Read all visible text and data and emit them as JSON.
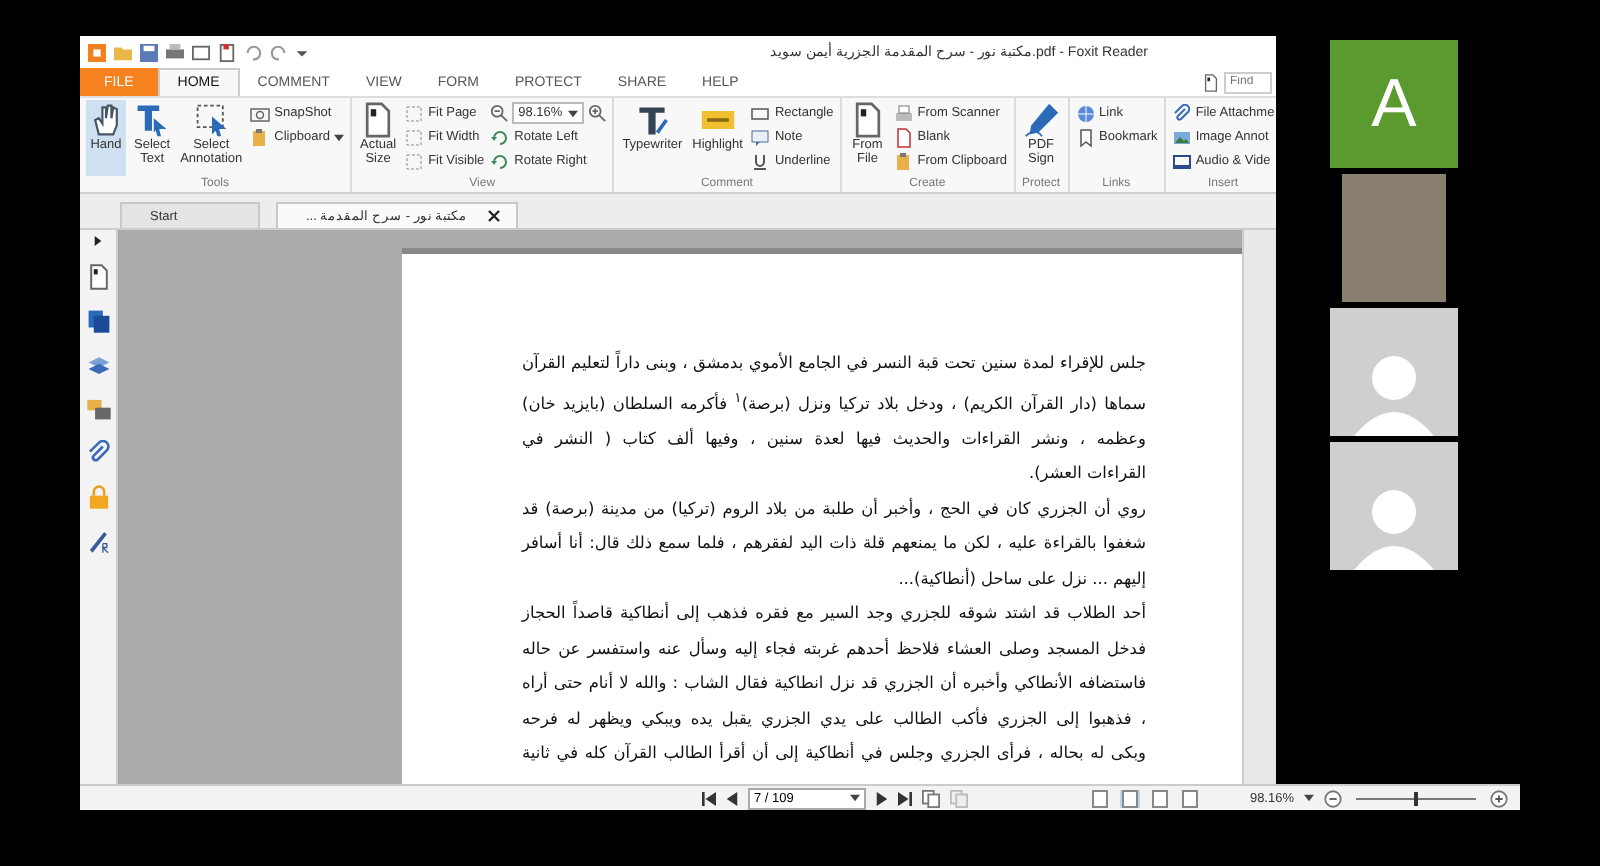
{
  "window": {
    "title": "مكتبة نور - سرح المقدمة الجزرية أيمن سويد.pdf - Foxit Reader"
  },
  "menu_tabs": [
    {
      "label": "FILE",
      "kind": "file",
      "selected": false
    },
    {
      "label": "HOME",
      "kind": "tab",
      "selected": true
    },
    {
      "label": "COMMENT",
      "kind": "tab",
      "selected": false
    },
    {
      "label": "VIEW",
      "kind": "tab",
      "selected": false
    },
    {
      "label": "FORM",
      "kind": "tab",
      "selected": false
    },
    {
      "label": "PROTECT",
      "kind": "tab",
      "selected": false
    },
    {
      "label": "SHARE",
      "kind": "tab",
      "selected": false
    },
    {
      "label": "HELP",
      "kind": "tab",
      "selected": false
    }
  ],
  "find": {
    "placeholder": "Find"
  },
  "ribbon": {
    "groups": [
      {
        "label": "Tools",
        "columns": [
          {
            "kind": "large",
            "items": [
              {
                "label": "Hand",
                "selected": true
              }
            ]
          },
          {
            "kind": "large",
            "items": [
              {
                "label": "Select Text",
                "selected": false
              }
            ]
          },
          {
            "kind": "large",
            "items": [
              {
                "label": "Select Annotation",
                "selected": false
              }
            ]
          },
          {
            "kind": "small",
            "items": [
              {
                "label": "SnapShot"
              },
              {
                "label": "Clipboard",
                "dropdown": true
              }
            ]
          }
        ]
      },
      {
        "label": "View",
        "columns": [
          {
            "kind": "large",
            "items": [
              {
                "label": "Actual Size"
              }
            ]
          },
          {
            "kind": "small",
            "items": [
              {
                "label": "Fit Page"
              },
              {
                "label": "Fit Width"
              },
              {
                "label": "Fit Visible"
              }
            ]
          },
          {
            "kind": "small",
            "items": [
              {
                "kind": "zoom",
                "value": "98.16%"
              },
              {
                "label": "Rotate Left"
              },
              {
                "label": "Rotate Right"
              }
            ]
          }
        ]
      },
      {
        "label": "Comment",
        "columns": [
          {
            "kind": "large",
            "items": [
              {
                "label": "Typewriter"
              }
            ]
          },
          {
            "kind": "large",
            "items": [
              {
                "label": "Highlight"
              }
            ]
          },
          {
            "kind": "small",
            "items": [
              {
                "label": "Rectangle"
              },
              {
                "label": "Note"
              },
              {
                "label": "Underline"
              }
            ]
          }
        ]
      },
      {
        "label": "Create",
        "columns": [
          {
            "kind": "large",
            "items": [
              {
                "label": "From File"
              }
            ]
          },
          {
            "kind": "small",
            "items": [
              {
                "label": "From Scanner"
              },
              {
                "label": "Blank"
              },
              {
                "label": "From Clipboard"
              }
            ]
          }
        ]
      },
      {
        "label": "Protect",
        "columns": [
          {
            "kind": "large",
            "items": [
              {
                "label": "PDF Sign"
              }
            ]
          }
        ]
      },
      {
        "label": "Links",
        "columns": [
          {
            "kind": "small",
            "items": [
              {
                "label": "Link"
              },
              {
                "label": "Bookmark"
              }
            ]
          }
        ]
      },
      {
        "label": "Insert",
        "columns": [
          {
            "kind": "small",
            "items": [
              {
                "label": "File Attachme"
              },
              {
                "label": "Image Annot"
              },
              {
                "label": "Audio & Vide"
              }
            ]
          }
        ]
      }
    ]
  },
  "doc_tabs": [
    {
      "label": "Start",
      "selected": false,
      "closable": false
    },
    {
      "label": "... مكتبة نور - سرح المقدمة",
      "selected": true,
      "closable": true
    }
  ],
  "page": {
    "lines": [
      {
        "text": "جلس للإقراء لمدة سنين تحت قبة النسر في الجامع الأموي بدمشق ، وبنى داراً لتعليم القرآن",
        "last": false
      },
      {
        "text": "سماها (دار القرآن الكريم) ، ودخل بلاد تركيا ونزل (برصة)$^{١}$ فأكرمه السلطان (بايزيد خان)",
        "last": false
      },
      {
        "text": "وعظمه ، ونشر القراءات والحديث فيها لعدة سنين ، وفيها ألف كتاب ( النشر في",
        "last": false
      },
      {
        "text": "القراءات العشر).",
        "last": true
      },
      {
        "text": "روي أن الجزري كان في الحج ، وأخبر أن طلبة من بلاد الروم (تركيا) من مدينة (برصة) قد",
        "last": false
      },
      {
        "text": "شغفوا بالقراءة عليه ، لكن ما يمنعهم قلة ذات اليد لفقرهم ، فلما سمع ذلك قال: أنا أسافر",
        "last": false
      },
      {
        "text": "إليهم ... نزل على ساحل (أنطاكية)...",
        "last": true
      },
      {
        "text": "أحد الطلاب قد اشتد شوقه للجزري وجد السير مع فقره فذهب إلى أنطاكية قاصداً الحجاز",
        "last": false
      },
      {
        "text": "فدخل المسجد وصلى العشاء فلاحظ أحدهم غربته فجاء إليه وسأل عنه واستفسر عن حاله",
        "last": false
      },
      {
        "text": "فاستضافه الأنطاكي وأخبره أن الجزري قد نزل انطاكية فقال الشاب : والله لا أنام حتى أراه",
        "last": false
      },
      {
        "text": "، فذهبوا إلى الجزري فأكب الطالب على يدي الجزري يقبل يده ويبكي ويظهر له فرحه",
        "last": false
      },
      {
        "text": "وبكى له بحاله ، فرأى الجزري وجلس في أنطاكية إلى أن أقرأ الطالب القرآن كله في ثانية",
        "last": false
      }
    ]
  },
  "status_bar": {
    "page_field": "7 / 109",
    "view_modes": [
      {
        "selected": false
      },
      {
        "selected": true
      },
      {
        "selected": false
      },
      {
        "selected": false
      }
    ],
    "zoom": "98.16%",
    "zoom_slider": {
      "level": 0.5
    }
  },
  "participants": [
    {
      "kind": "initial",
      "initial": "A",
      "color": "#5b9a2f"
    },
    {
      "kind": "video"
    },
    {
      "kind": "avatar"
    },
    {
      "kind": "avatar"
    }
  ]
}
